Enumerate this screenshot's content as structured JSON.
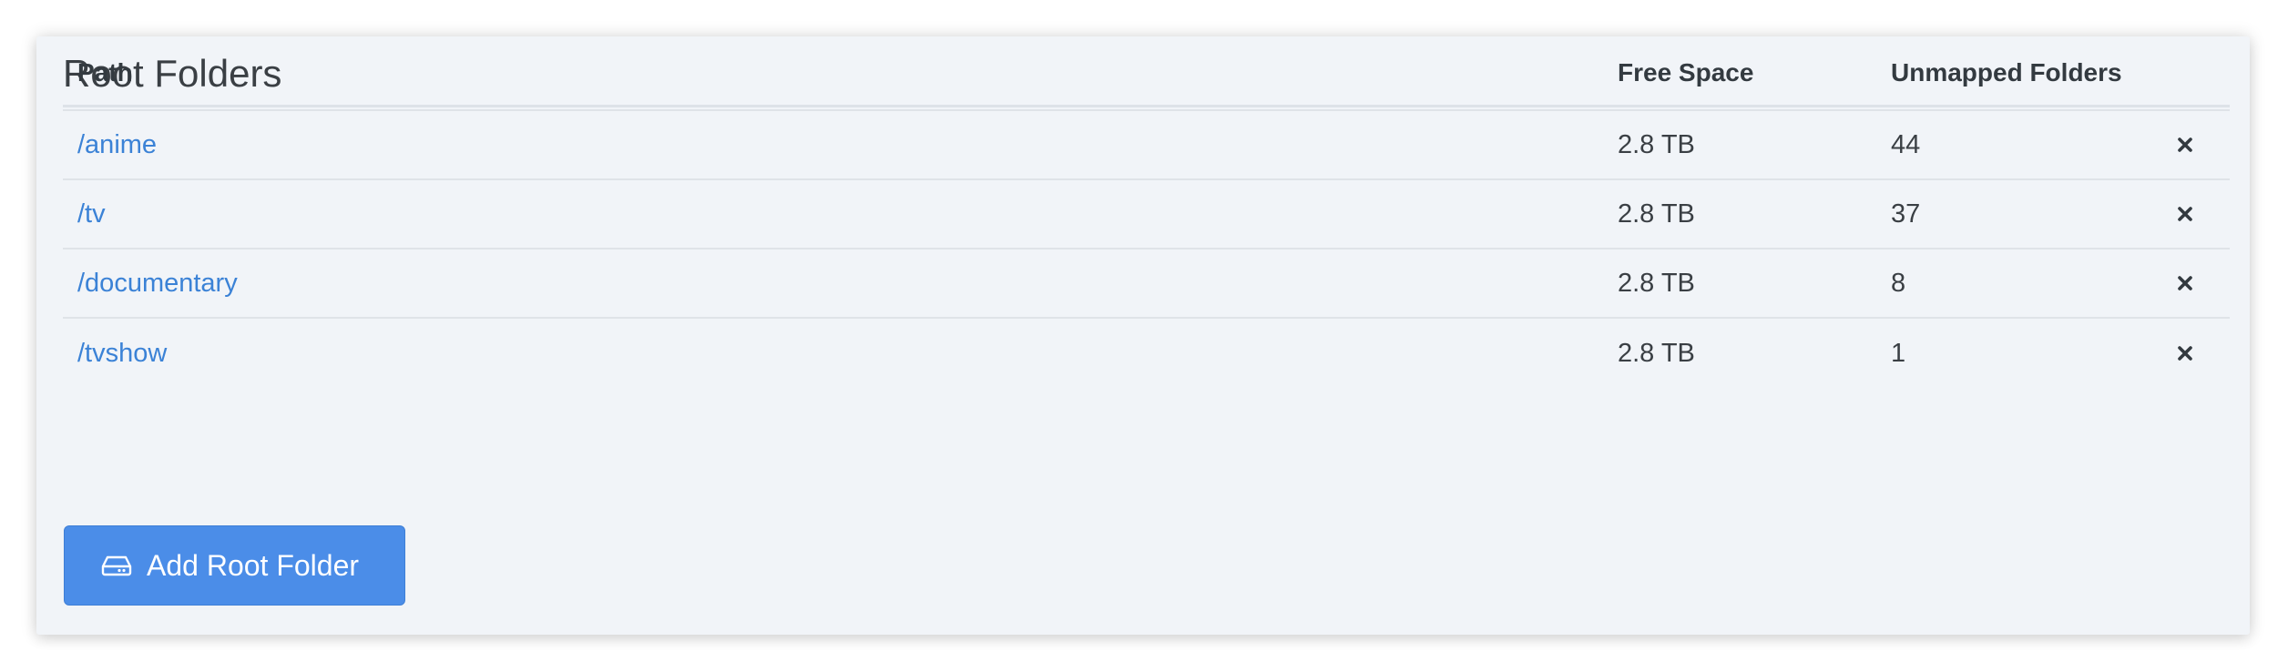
{
  "section": {
    "title": "Root Folders"
  },
  "table": {
    "headers": {
      "path": "Path",
      "free_space": "Free Space",
      "unmapped_folders": "Unmapped Folders"
    },
    "rows": [
      {
        "path": "/anime",
        "free_space": "2.8 TB",
        "unmapped_folders": "44"
      },
      {
        "path": "/tv",
        "free_space": "2.8 TB",
        "unmapped_folders": "37"
      },
      {
        "path": "/documentary",
        "free_space": "2.8 TB",
        "unmapped_folders": "8"
      },
      {
        "path": "/tvshow",
        "free_space": "2.8 TB",
        "unmapped_folders": "1"
      }
    ],
    "remove_icon": "close-icon"
  },
  "add_button": {
    "label": "Add Root Folder",
    "icon": "hard-drive-icon"
  },
  "colors": {
    "link": "#3b82d6",
    "primary_button": "#4b8de8",
    "panel_background": "#f1f4f8"
  }
}
